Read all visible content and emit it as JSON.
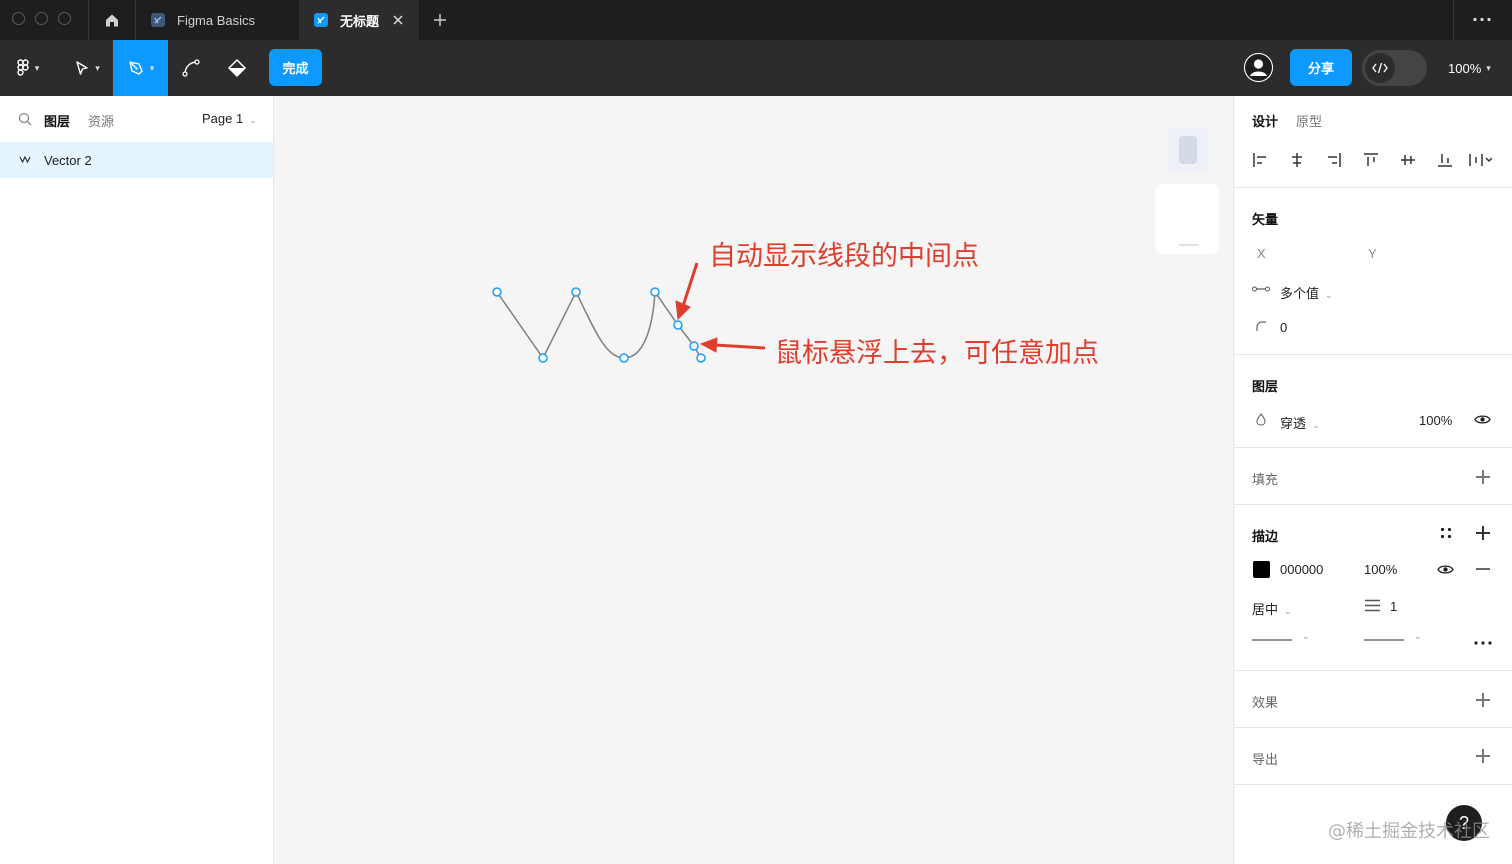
{
  "titlebar": {
    "tabs": [
      {
        "label": "Figma Basics",
        "active": false
      },
      {
        "label": "无标题",
        "active": true
      }
    ]
  },
  "toolbar": {
    "done_label": "完成",
    "share_label": "分享",
    "zoom": "100%"
  },
  "left_panel": {
    "tabs": [
      "图层",
      "资源"
    ],
    "page": "Page 1",
    "layers": [
      {
        "name": "Vector 2"
      }
    ]
  },
  "canvas": {
    "annotations": [
      "自动显示线段的中间点",
      "鼠标悬浮上去，可任意加点"
    ]
  },
  "right_panel": {
    "tabs": [
      "设计",
      "原型"
    ],
    "vector": {
      "title": "矢量",
      "x_label": "X",
      "y_label": "Y",
      "multi_value": "多个值",
      "corner_radius": "0"
    },
    "layer": {
      "title": "图层",
      "blend_mode": "穿透",
      "opacity": "100%"
    },
    "fill": {
      "title": "填充"
    },
    "stroke": {
      "title": "描边",
      "color_hex": "000000",
      "opacity": "100%",
      "position": "居中",
      "weight": "1"
    },
    "effects": {
      "title": "效果"
    },
    "export": {
      "title": "导出"
    }
  },
  "watermark": "@稀土掘金技术社区",
  "help": "?",
  "colors": {
    "accent": "#0d99ff",
    "annotation": "#e03e2d",
    "selection": "#e5f4ff"
  }
}
